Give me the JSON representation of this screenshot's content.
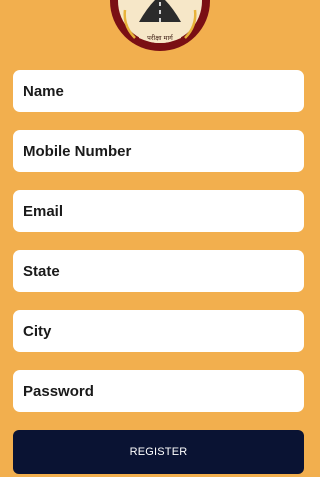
{
  "logo": {
    "text": "परीक्षा मार्ग",
    "icon": "road-emblem-logo"
  },
  "form": {
    "fields": [
      {
        "name": "name-field",
        "placeholder": "Name",
        "value": ""
      },
      {
        "name": "mobile-number-field",
        "placeholder": "Mobile Number",
        "value": ""
      },
      {
        "name": "email-field",
        "placeholder": "Email",
        "value": ""
      },
      {
        "name": "state-field",
        "placeholder": "State",
        "value": ""
      },
      {
        "name": "city-field",
        "placeholder": "City",
        "value": ""
      },
      {
        "name": "password-field",
        "placeholder": "Password",
        "value": ""
      }
    ],
    "register_label": "REGISTER"
  },
  "colors": {
    "background": "#F2AF4E",
    "field_background": "#FFFFFF",
    "button_background": "#0A1333",
    "logo_ring": "#7A0F14",
    "logo_gold": "#E8B33A"
  }
}
